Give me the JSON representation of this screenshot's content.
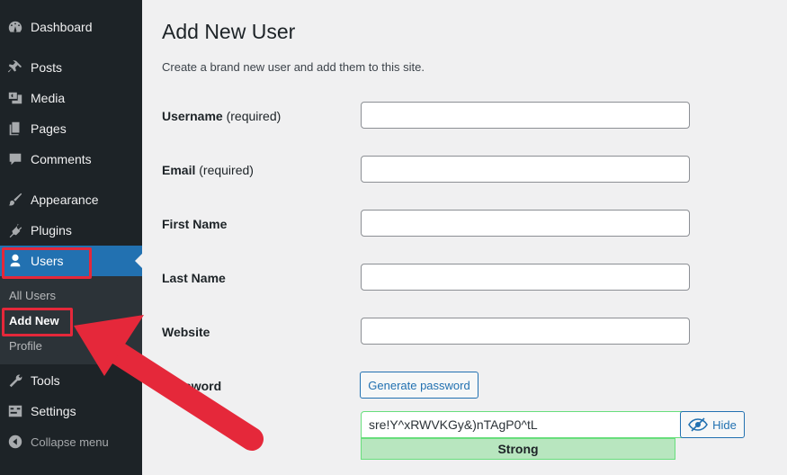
{
  "sidebar": {
    "items": [
      {
        "label": "Dashboard",
        "icon": "dashboard-icon"
      },
      {
        "label": "Posts",
        "icon": "pin-icon"
      },
      {
        "label": "Media",
        "icon": "media-icon"
      },
      {
        "label": "Pages",
        "icon": "pages-icon"
      },
      {
        "label": "Comments",
        "icon": "comment-icon"
      },
      {
        "label": "Appearance",
        "icon": "brush-icon"
      },
      {
        "label": "Plugins",
        "icon": "plugin-icon"
      },
      {
        "label": "Users",
        "icon": "user-icon"
      },
      {
        "label": "Tools",
        "icon": "wrench-icon"
      },
      {
        "label": "Settings",
        "icon": "settings-icon"
      },
      {
        "label": "Collapse menu",
        "icon": "collapse-icon"
      }
    ],
    "users_submenu": [
      "All Users",
      "Add New",
      "Profile"
    ]
  },
  "main": {
    "title": "Add New User",
    "description": "Create a brand new user and add them to this site.",
    "fields": [
      {
        "label": "Username",
        "note": "(required)",
        "value": ""
      },
      {
        "label": "Email",
        "note": "(required)",
        "value": ""
      },
      {
        "label": "First Name",
        "note": "",
        "value": ""
      },
      {
        "label": "Last Name",
        "note": "",
        "value": ""
      },
      {
        "label": "Website",
        "note": "",
        "value": ""
      }
    ],
    "password": {
      "label": "Password",
      "generate_button": "Generate password",
      "value": "sre!Y^xRWVKGy&)nTAgP0^tL",
      "strength": "Strong",
      "hide_button": "Hide"
    }
  },
  "colors": {
    "sidebar_bg": "#1d2327",
    "submenu_bg": "#2c3338",
    "accent": "#2271b1",
    "highlight": "#e5283a",
    "strength_bg": "#b8e6bf"
  }
}
